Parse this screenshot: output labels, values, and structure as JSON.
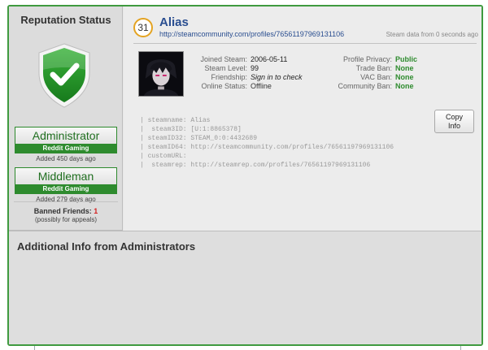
{
  "sidebar": {
    "title": "Reputation Status",
    "shield_icon": "shield-check-icon",
    "ranks": [
      {
        "name": "Administrator",
        "group": "Reddit Gaming",
        "added": "Added 450 days ago"
      },
      {
        "name": "Middleman",
        "group": "Reddit Gaming",
        "added": "Added 279 days ago"
      }
    ],
    "banned_label": "Banned Friends:",
    "banned_count": "1",
    "banned_note": "(possibly for appeals)"
  },
  "profile": {
    "level": "31",
    "persona": "Alias",
    "url": "http://steamcommunity.com/profiles/76561197969131106",
    "freshness": "Steam data from 0 seconds ago",
    "left_fields": [
      {
        "key": "Joined Steam:",
        "value": "2006-05-11"
      },
      {
        "key": "Steam Level:",
        "value": "99"
      },
      {
        "key": "Friendship:",
        "value": "Sign in to check"
      },
      {
        "key": "Online Status:",
        "value": "Offline"
      }
    ],
    "right_fields": [
      {
        "key": "Profile Privacy:",
        "value": "Public"
      },
      {
        "key": "Trade Ban:",
        "value": "None"
      },
      {
        "key": "VAC Ban:",
        "value": "None"
      },
      {
        "key": "Community Ban:",
        "value": "None"
      }
    ],
    "code_lines": [
      "| steamname: Alias",
      "|  steam3ID: [U:1:8865378]",
      "| steamID32: STEAM_0:0:4432689",
      "| steamID64: http://steamcommunity.com/profiles/76561197969131106",
      "| customURL:",
      "|  steamrep: http://steamrep.com/profiles/76561197969131106"
    ],
    "copy_button": {
      "line1": "Copy",
      "line2": "Info"
    }
  },
  "additional": {
    "title": "Additional Info from Administrators"
  },
  "colors": {
    "frame": "#3f9a3f",
    "accent_green": "#2e8b2e",
    "link_blue": "#2a4e90",
    "level_ring": "#e4a321",
    "banned_red": "#d42020"
  }
}
